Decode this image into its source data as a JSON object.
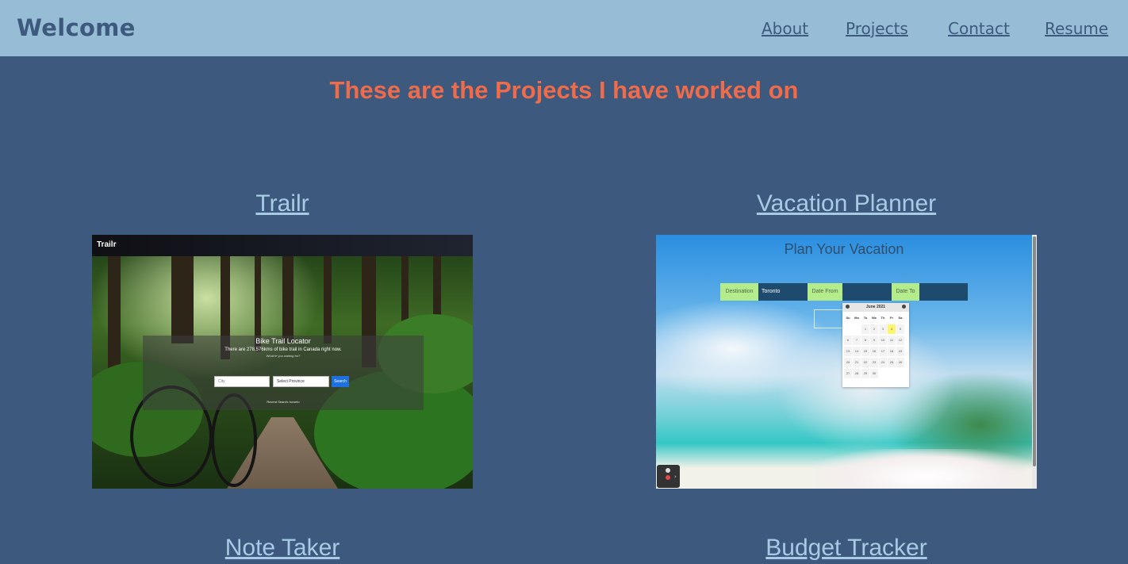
{
  "navbar": {
    "brand": "Welcome",
    "links": [
      "About",
      "Projects",
      "Contact",
      "Resume"
    ]
  },
  "heading": "These are the Projects I have worked on",
  "projects": [
    {
      "title": "Trailr",
      "screenshot": {
        "app_name": "Trailr",
        "heading": "Bike Trail Locator",
        "subheading": "There are 278,576kms of bike trail in Canada right now.",
        "tagline": "What're you waiting for?",
        "city_placeholder": "City",
        "province_select": "Select Province",
        "search_button": "Search",
        "recent_search": "Recent Search: toronto"
      }
    },
    {
      "title": "Vacation Planner",
      "screenshot": {
        "heading": "Plan Your Vacation",
        "destination_label": "Destination",
        "destination_value": "Toronto",
        "date_from_label": "Date From",
        "date_to_label": "Date To",
        "calendar_month": "June 2021",
        "weekdays": [
          "Su",
          "Mo",
          "Tu",
          "We",
          "Th",
          "Fr",
          "Sa"
        ],
        "days": [
          "1",
          "2",
          "3",
          "4",
          "5",
          "6",
          "7",
          "8",
          "9",
          "10",
          "11",
          "12",
          "13",
          "14",
          "15",
          "16",
          "17",
          "18",
          "19",
          "20",
          "21",
          "22",
          "23",
          "24",
          "25",
          "26",
          "27",
          "28",
          "29",
          "30"
        ],
        "highlighted_day": "4"
      }
    },
    {
      "title": "Note Taker"
    },
    {
      "title": "Budget Tracker"
    }
  ]
}
